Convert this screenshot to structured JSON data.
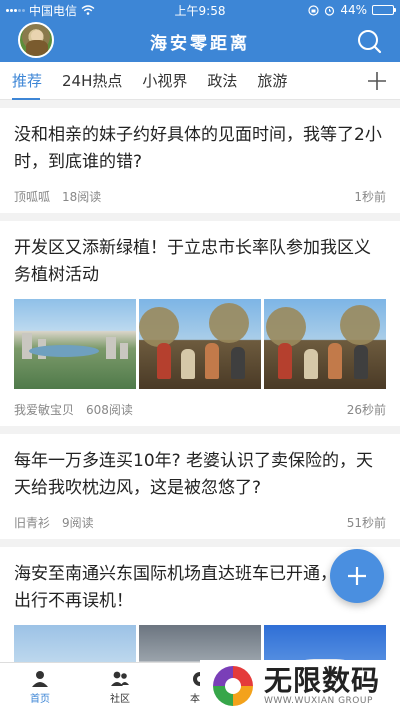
{
  "status_bar": {
    "carrier": "中国电信",
    "time": "上午9:58",
    "battery": "44%",
    "battery_level": 0.44
  },
  "header": {
    "title": "海安零距离"
  },
  "tabs": [
    {
      "label": "推荐",
      "active": true
    },
    {
      "label": "24H热点",
      "active": false
    },
    {
      "label": "小视界",
      "active": false
    },
    {
      "label": "政法",
      "active": false
    },
    {
      "label": "旅游",
      "active": false
    }
  ],
  "feed": [
    {
      "title": "没和相亲的妹子约好具体的见面时间，我等了2小时，到底谁的错?",
      "author": "顶呱呱",
      "reads": "18阅读",
      "time": "1秒前"
    },
    {
      "title": "开发区又添新绿植！于立忠市长率队参加我区义务植树活动",
      "author": "我爱敏宝贝",
      "reads": "608阅读",
      "time": "26秒前"
    },
    {
      "title": "每年一万多连买10年? 老婆认识了卖保险的，天天给我吹枕边风，这是被忽悠了?",
      "author": "旧青衫",
      "reads": "9阅读",
      "time": "51秒前"
    },
    {
      "title": "海安至南通兴东国际机场直达班车已开通，一步出行不再误机！"
    }
  ],
  "bottom_nav": [
    {
      "label": "首页",
      "icon": "person-icon",
      "active": true
    },
    {
      "label": "社区",
      "icon": "group-icon",
      "active": false
    },
    {
      "label": "本地",
      "icon": "location-icon",
      "active": false
    }
  ],
  "watermark": {
    "main": "无限数码",
    "sub": "WWW.WUXIAN GROUP"
  },
  "colors": {
    "brand_blue": "#3d86d6",
    "fab_blue": "#4a8fe0"
  }
}
